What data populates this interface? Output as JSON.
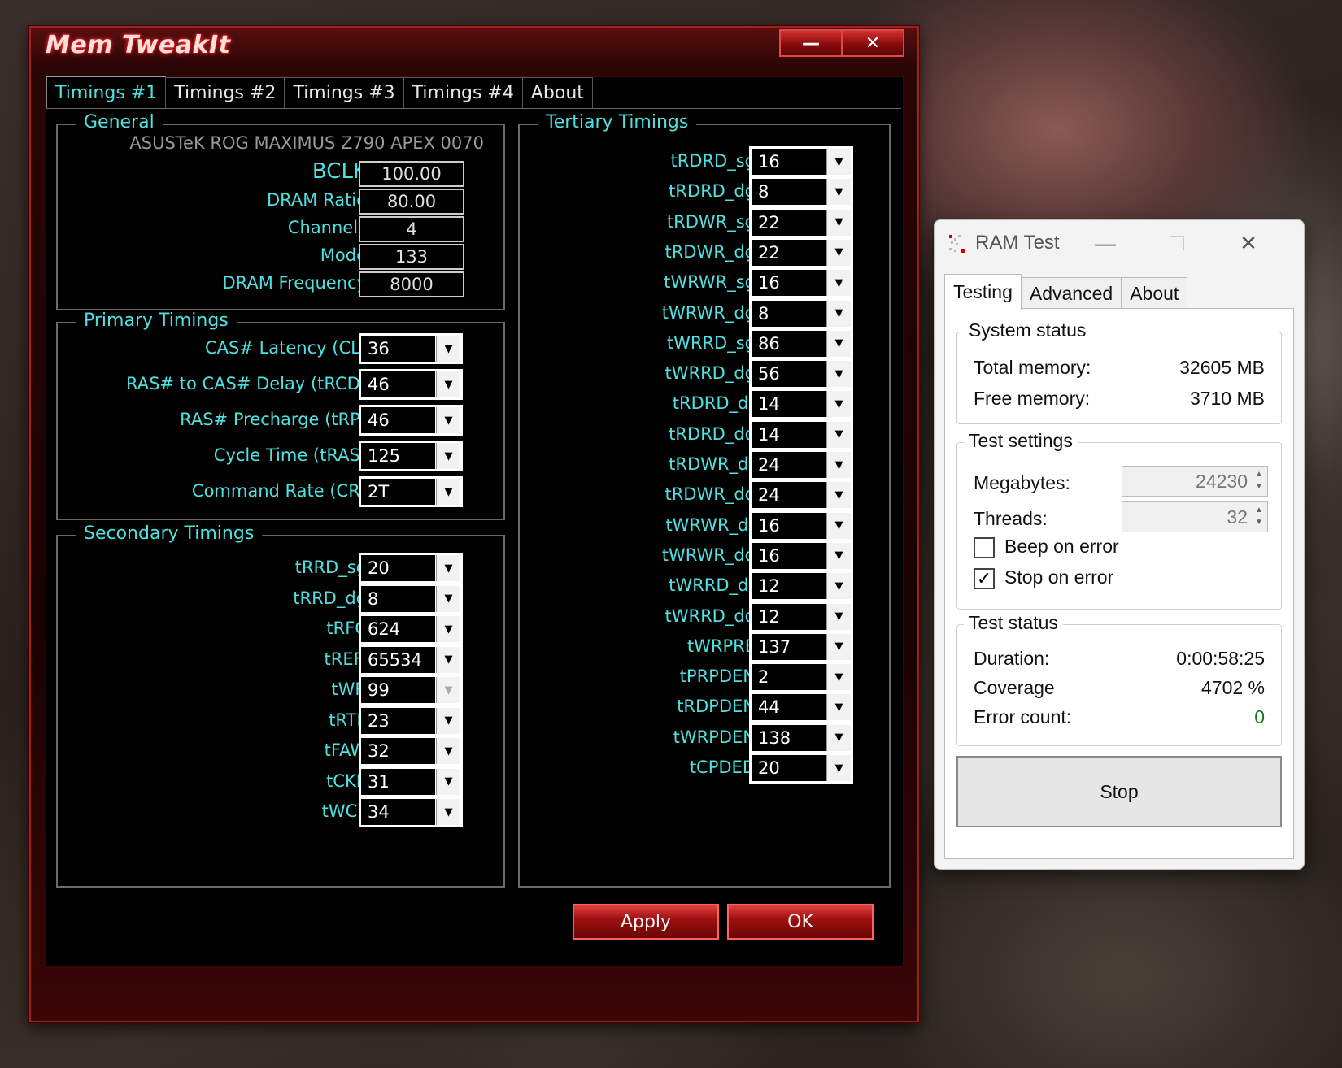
{
  "mti": {
    "title": "Mem TweakIt",
    "minimize": "—",
    "close": "✕",
    "tabs": [
      "Timings #1",
      "Timings #2",
      "Timings #3",
      "Timings #4",
      "About"
    ],
    "general": {
      "title": "General",
      "board": "ASUSTeK ROG MAXIMUS Z790 APEX 0070",
      "rows": [
        {
          "label": "BCLK",
          "value": "100.00"
        },
        {
          "label": "DRAM Ratio",
          "value": "80.00"
        },
        {
          "label": "Channels",
          "value": "4"
        },
        {
          "label": "Mode",
          "value": "133"
        },
        {
          "label": "DRAM Frequency",
          "value": "8000"
        }
      ]
    },
    "primary": {
      "title": "Primary Timings",
      "rows": [
        {
          "label": "CAS# Latency (CL)",
          "value": "36"
        },
        {
          "label": "RAS# to CAS# Delay (tRCD)",
          "value": "46"
        },
        {
          "label": "RAS# Precharge (tRP)",
          "value": "46"
        },
        {
          "label": "Cycle Time (tRAS)",
          "value": "125"
        },
        {
          "label": "Command Rate (CR)",
          "value": "2T"
        }
      ]
    },
    "secondary": {
      "title": "Secondary Timings",
      "rows": [
        {
          "label": "tRRD_sg",
          "value": "20"
        },
        {
          "label": "tRRD_dg",
          "value": "8"
        },
        {
          "label": "tRFC",
          "value": "624"
        },
        {
          "label": "tREFi",
          "value": "65534"
        },
        {
          "label": "tWR",
          "value": "99"
        },
        {
          "label": "tRTP",
          "value": "23"
        },
        {
          "label": "tFAW",
          "value": "32"
        },
        {
          "label": "tCKE",
          "value": "31"
        },
        {
          "label": "tWCL",
          "value": "34"
        }
      ]
    },
    "tertiary": {
      "title": "Tertiary Timings",
      "rows": [
        {
          "label": "tRDRD_sg",
          "value": "16"
        },
        {
          "label": "tRDRD_dg",
          "value": "8"
        },
        {
          "label": "tRDWR_sg",
          "value": "22"
        },
        {
          "label": "tRDWR_dg",
          "value": "22"
        },
        {
          "label": "tWRWR_sg",
          "value": "16"
        },
        {
          "label": "tWRWR_dg",
          "value": "8"
        },
        {
          "label": "tWRRD_sg",
          "value": "86"
        },
        {
          "label": "tWRRD_dg",
          "value": "56"
        },
        {
          "label": "tRDRD_dr",
          "value": "14"
        },
        {
          "label": "tRDRD_dd",
          "value": "14"
        },
        {
          "label": "tRDWR_dr",
          "value": "24"
        },
        {
          "label": "tRDWR_dd",
          "value": "24"
        },
        {
          "label": "tWRWR_dr",
          "value": "16"
        },
        {
          "label": "tWRWR_dd",
          "value": "16"
        },
        {
          "label": "tWRRD_dr",
          "value": "12"
        },
        {
          "label": "tWRRD_dd",
          "value": "12"
        },
        {
          "label": "tWRPRE",
          "value": "137"
        },
        {
          "label": "tPRPDEN",
          "value": "2"
        },
        {
          "label": "tRDPDEN",
          "value": "44"
        },
        {
          "label": "tWRPDEN",
          "value": "138"
        },
        {
          "label": "tCPDED",
          "value": "20"
        }
      ]
    },
    "apply": "Apply",
    "ok": "OK"
  },
  "ramtest": {
    "title": "RAM Test",
    "tabs": [
      "Testing",
      "Advanced",
      "About"
    ],
    "system_status": {
      "title": "System status",
      "total_label": "Total memory:",
      "total_value": "32605 MB",
      "free_label": "Free memory:",
      "free_value": "3710 MB"
    },
    "test_settings": {
      "title": "Test settings",
      "megabytes_label": "Megabytes:",
      "megabytes_value": "24230",
      "threads_label": "Threads:",
      "threads_value": "32",
      "beep_label": "Beep on error",
      "beep_checked": false,
      "stop_label": "Stop on error",
      "stop_checked": true
    },
    "test_status": {
      "title": "Test status",
      "duration_label": "Duration:",
      "duration_value": "0:00:58:25",
      "coverage_label": "Coverage",
      "coverage_value": "4702 %",
      "errors_label": "Error count:",
      "errors_value": "0"
    },
    "stop_button": "Stop",
    "colors": {
      "error_count": "#1a7a1a",
      "accent_cyan": "#4fe0e0",
      "frame_red": "#a12020"
    }
  }
}
